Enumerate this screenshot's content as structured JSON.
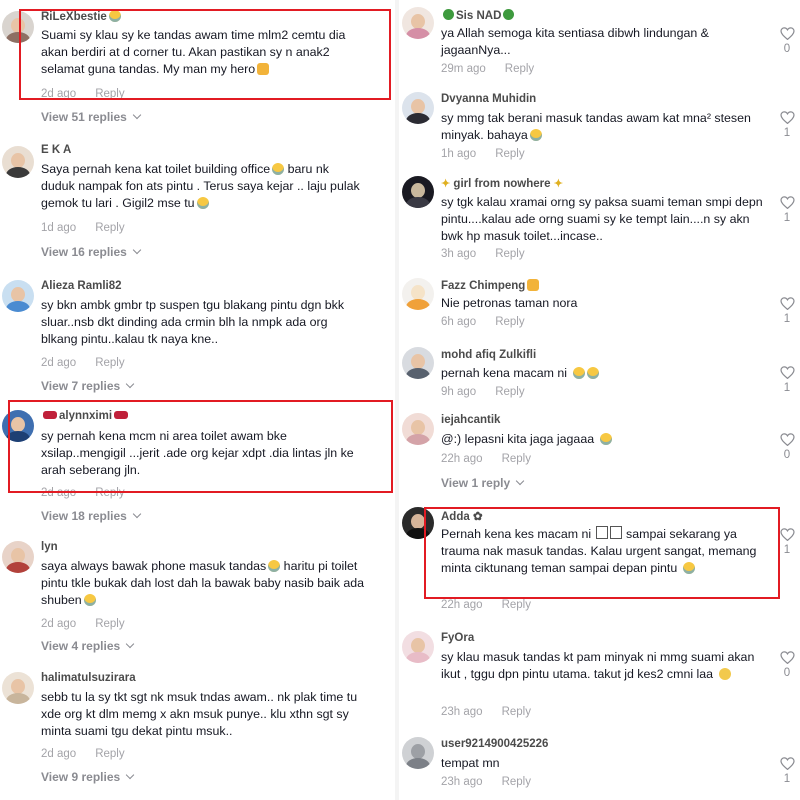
{
  "left_column": {
    "comments": [
      {
        "username": "RiLeXbestie",
        "text": "Suami sy klau sy ke tandas awam time mlm2 cemtu dia akan berdiri at d corner tu. Akan pastikan sy n anak2 selamat guna tandas. My man my hero",
        "time": "2d ago",
        "reply": "Reply",
        "view_replies": "View 51 replies"
      },
      {
        "username": "E K A",
        "text": "Saya pernah kena kat toilet building office",
        "text_b": " baru nk duduk nampak fon ats pintu . Terus saya kejar .. laju pulak gemok tu lari . Gigil2 mse tu",
        "time": "1d ago",
        "reply": "Reply",
        "view_replies": "View 16 replies"
      },
      {
        "username": "Alieza Ramli82",
        "text": "sy bkn ambk gmbr tp suspen tgu blakang pintu dgn bkk sluar..nsb dkt dinding ada crmin blh la nmpk ada org blkang pintu..kalau tk naya kne..",
        "time": "2d ago",
        "reply": "Reply",
        "view_replies": "View 7 replies"
      },
      {
        "username": "alynnximi",
        "text": "sy pernah kena mcm ni area toilet awam bke xsilap..mengigil ...jerit .ade org kejar xdpt .dia lintas jln ke arah seberang jln.",
        "time": "2d ago",
        "reply": "Reply",
        "view_replies": "View 18 replies"
      },
      {
        "username": "lyn",
        "text": "saya always bawak phone masuk tandas",
        "text_b": " haritu pi toilet pintu tkle bukak dah lost dah la bawak baby nasib baik ada shuben",
        "time": "2d ago",
        "reply": "Reply",
        "view_replies": "View 4 replies"
      },
      {
        "username": "halimatulsuzirara",
        "text": "sebb tu la sy tkt sgt nk msuk tndas awam.. nk plak time tu xde org kt dlm memg x akn msuk punye.. klu xthn sgt sy minta suami tgu dekat pintu msuk..",
        "time": "2d ago",
        "reply": "Reply",
        "view_replies": "View 9 replies"
      }
    ]
  },
  "right_column": {
    "comments": [
      {
        "username": "Sis NAD",
        "text": "ya Allah semoga kita sentiasa dibwh lindungan & jagaanNya...",
        "time": "29m ago",
        "reply": "Reply",
        "likes": "0"
      },
      {
        "username": "Dvyanna Muhidin",
        "text": "sy mmg tak berani masuk tandas awam kat mna² stesen minyak. bahaya",
        "time": "1h ago",
        "reply": "Reply",
        "likes": "1"
      },
      {
        "username": "girl from nowhere",
        "text": "sy tgk kalau xramai orng sy paksa suami teman smpi depn pintu....kalau ade orng suami sy ke tempt lain....n sy akn bwk hp masuk toilet...incase..",
        "time": "3h ago",
        "reply": "Reply",
        "likes": "1"
      },
      {
        "username": "Fazz Chimpeng",
        "text": "Nie petronas taman nora",
        "time": "6h ago",
        "reply": "Reply",
        "likes": "1"
      },
      {
        "username": "mohd afiq Zulkifli",
        "text": "pernah kena macam ni",
        "time": "9h ago",
        "reply": "Reply",
        "likes": "1"
      },
      {
        "username": "iejahcantik",
        "text": "@:) lepasni kita jaga jagaaa",
        "time": "22h ago",
        "reply": "Reply",
        "likes": "0",
        "view_replies": "View 1 reply"
      },
      {
        "username": "Adda",
        "text": "Pernah kena kes macam ni",
        "text_b": " sampai sekarang ya trauma nak masuk tandas. Kalau urgent sangat, memang minta ciktunang teman sampai depan pintu",
        "time": "22h ago",
        "reply": "Reply",
        "likes": "1"
      },
      {
        "username": "FyOra",
        "text": "sy klau masuk tandas kt pam minyak ni mmg suami akan ikut , tggu dpn pintu utama. takut jd kes2 cmni laa",
        "time": "23h ago",
        "reply": "Reply",
        "likes": "0"
      },
      {
        "username": "user9214900425226",
        "text": "tempat mn",
        "time": "23h ago",
        "reply": "Reply",
        "likes": "1"
      }
    ]
  },
  "colors": {
    "highlight": "#e21b23",
    "muted": "#a3a3a8",
    "text": "#161823",
    "username": "#4b4b4b"
  }
}
